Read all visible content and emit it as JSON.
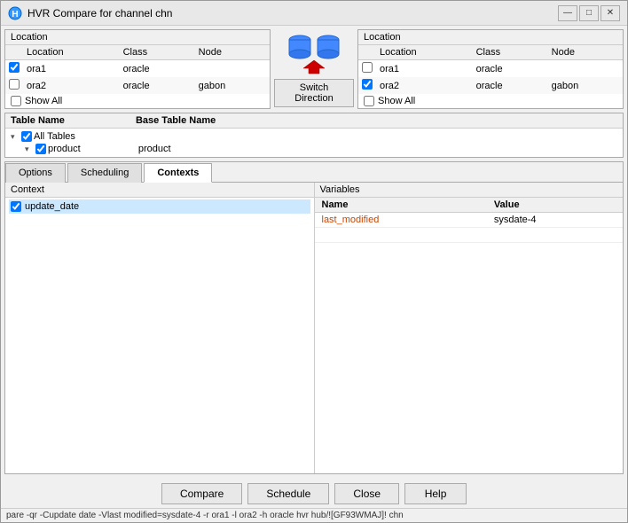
{
  "window": {
    "title": "HVR Compare for channel chn",
    "minimize": "—",
    "maximize": "□",
    "close": "✕"
  },
  "left_location": {
    "panel_title": "Location",
    "columns": [
      "Location",
      "Class",
      "Node"
    ],
    "rows": [
      {
        "checked": true,
        "location": "ora1",
        "class": "oracle",
        "node": ""
      },
      {
        "checked": false,
        "location": "ora2",
        "class": "oracle",
        "node": "gabon"
      }
    ],
    "show_all_label": "Show All"
  },
  "switch": {
    "button_label": "Switch Direction"
  },
  "right_location": {
    "panel_title": "Location",
    "columns": [
      "Location",
      "Class",
      "Node"
    ],
    "rows": [
      {
        "checked": false,
        "location": "ora1",
        "class": "oracle",
        "node": ""
      },
      {
        "checked": true,
        "location": "ora2",
        "class": "oracle",
        "node": "gabon"
      }
    ],
    "show_all_label": "Show All"
  },
  "tables": {
    "col1": "Table Name",
    "col2": "Base Table Name",
    "tree": {
      "root_label": "All Tables",
      "child_label": "product",
      "child_base": "product"
    }
  },
  "tabs": {
    "items": [
      "Options",
      "Scheduling",
      "Contexts"
    ],
    "active_index": 2
  },
  "context_panel": {
    "title": "Context",
    "items": [
      {
        "checked": true,
        "label": "update_date"
      }
    ]
  },
  "variables_panel": {
    "title": "Variables",
    "col_name": "Name",
    "col_value": "Value",
    "rows": [
      {
        "name": "last_modified",
        "value": "sysdate-4"
      }
    ]
  },
  "buttons": {
    "compare": "Compare",
    "schedule": "Schedule",
    "close": "Close",
    "help": "Help"
  },
  "status_bar": {
    "text": "pare -qr -Cupdate date -Vlast modified=sysdate-4 -r ora1 -l ora2 -h oracle hvr hub/![GF93WMAJ]! chn"
  }
}
